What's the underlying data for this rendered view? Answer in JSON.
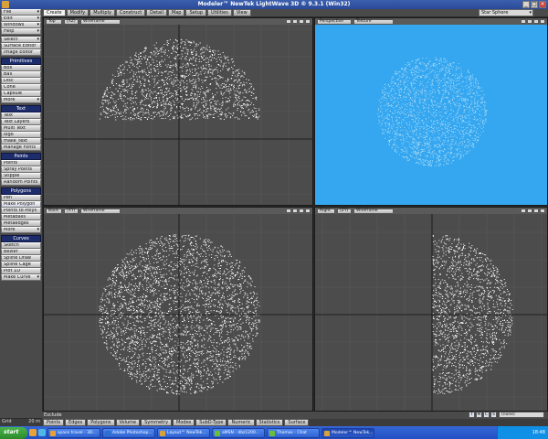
{
  "window": {
    "title": "Modeler™ NewTek LightWave 3D ® 9.3.1 (Win32)"
  },
  "left_menu": {
    "top_items": [
      "File",
      "Edit",
      "Windows",
      "Help",
      "Select",
      "Surface Editor",
      "Image Editor"
    ],
    "sections": [
      {
        "header": "Primitives",
        "items": [
          "Box",
          "Ball",
          "Disc",
          "Cone",
          "Capsule",
          "More"
        ]
      },
      {
        "header": "Text",
        "items": [
          "Text",
          "Text Layers",
          "Multi Text",
          "logo",
          "make_text",
          "Manage Fonts"
        ]
      },
      {
        "header": "Points",
        "items": [
          "Points",
          "Spray Points",
          "Stipple",
          "Random Points"
        ]
      },
      {
        "header": "Polygons",
        "items": [
          "Pen",
          "Make Polygon",
          "Points to Polys",
          "Metaballs",
          "Metaedges",
          "More"
        ]
      },
      {
        "header": "Curves",
        "items": [
          "Sketch",
          "Bezier",
          "Spline Draw",
          "Spline Cage",
          "Plot 1D",
          "Make Curve"
        ]
      }
    ]
  },
  "tabs": [
    "Create",
    "Modify",
    "Multiply",
    "Construct",
    "Detail",
    "Map",
    "Setup",
    "Utilities",
    "View"
  ],
  "active_tab": "Create",
  "object_selector": "Star Sphere",
  "viewports": [
    {
      "view": "Top",
      "axis": "(XZ)",
      "mode": "Wireframe"
    },
    {
      "view": "Perspective",
      "axis": "",
      "mode": "Texture"
    },
    {
      "view": "Back",
      "axis": "(XY)",
      "mode": "Wireframe"
    },
    {
      "view": "Right",
      "axis": "(ZY)",
      "mode": "Wireframe"
    }
  ],
  "bottom_bar": {
    "exclude_label": "Exclude",
    "grid_label": "Grid",
    "grid_value": "20 m",
    "buttons": [
      "Points",
      "Edges",
      "Polygons",
      "Volume",
      "Symmetry",
      "Modes",
      "SubD-Type",
      "Numeric",
      "Statistics",
      "Surface"
    ],
    "tmcs": [
      "T",
      "M",
      "C",
      "S"
    ],
    "surface_select": "(none)"
  },
  "taskbar": {
    "start_label": "start",
    "tasks": [
      "space travel - 3D...",
      "Adobe Photoshop...",
      "Layout™ NewTek...",
      "aMSN - dbz1200...",
      "Thomas - Chat",
      "Modeler™ NewTek..."
    ],
    "clock": "18:48"
  },
  "colors": {
    "perspective_bg": "#35a7f0",
    "viewport_bg": "#4c4c4c",
    "menu_header": "#1d2c6b"
  }
}
